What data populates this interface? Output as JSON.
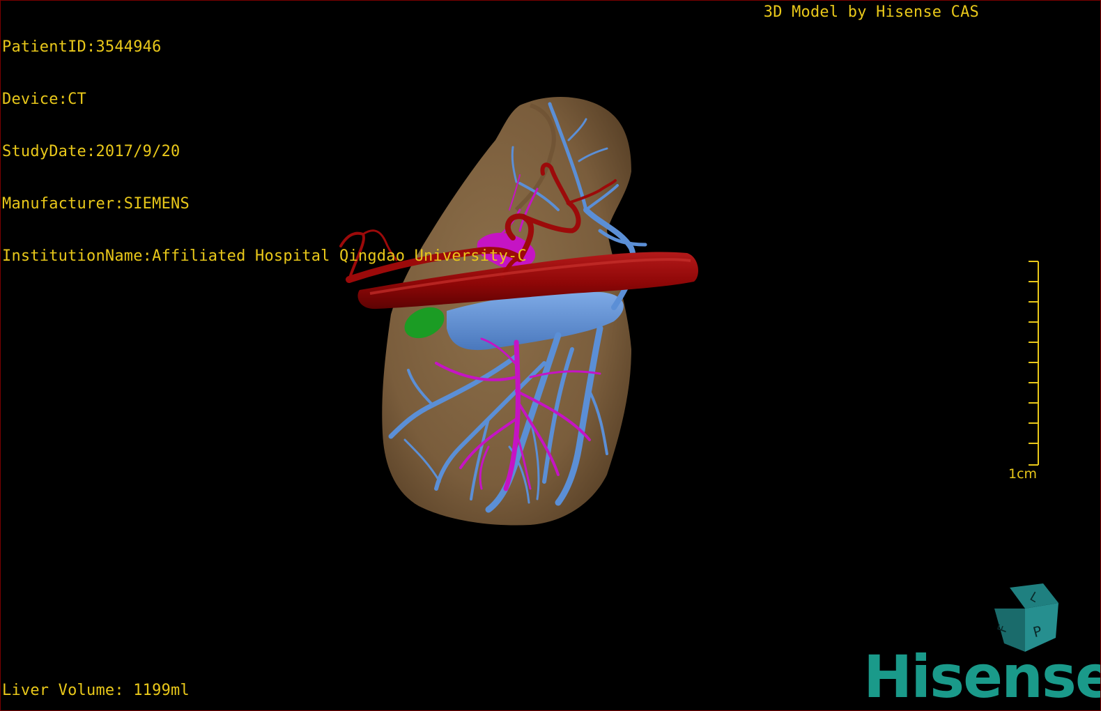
{
  "patient_info": {
    "patient_id": "PatientID:3544946",
    "device": "Device:CT",
    "study_date": "StudyDate:2017/9/20",
    "manufacturer": "Manufacturer:SIEMENS",
    "institution": "InstitutionName:Affiliated Hospital Qingdao University-C"
  },
  "credit": "3D Model by Hisense CAS",
  "liver_volume": "Liver Volume: 1199ml",
  "scale": {
    "label": "1cm"
  },
  "orientation_cube": {
    "faces": [
      "F",
      "L",
      "P"
    ]
  },
  "logo": "Hisense",
  "colors": {
    "overlay_text": "#e9c81a",
    "liver": "#806340",
    "artery": "#9c0a0a",
    "portal_vein": "#5b8fd6",
    "hepatic_vein": "#c514c4",
    "gallbladder": "#1b9c24",
    "logo": "#1a9a8a"
  }
}
